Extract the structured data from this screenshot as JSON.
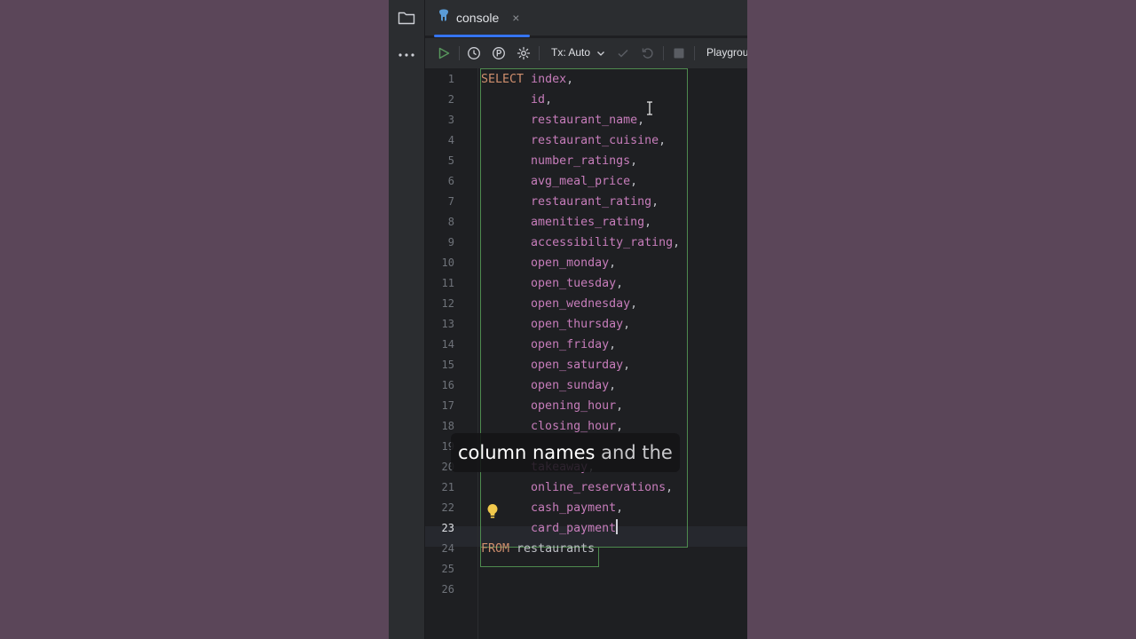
{
  "tab": {
    "label": "console",
    "close": "×"
  },
  "toolbar": {
    "tx_mode": "Tx: Auto",
    "session": "Playground"
  },
  "editor": {
    "lines": [
      {
        "n": "1",
        "keyword": "SELECT",
        "text": "index",
        "suffix": ","
      },
      {
        "n": "2",
        "text": "id",
        "suffix": ","
      },
      {
        "n": "3",
        "text": "restaurant_name",
        "suffix": ","
      },
      {
        "n": "4",
        "text": "restaurant_cuisine",
        "suffix": ","
      },
      {
        "n": "5",
        "text": "number_ratings",
        "suffix": ","
      },
      {
        "n": "6",
        "text": "avg_meal_price",
        "suffix": ","
      },
      {
        "n": "7",
        "text": "restaurant_rating",
        "suffix": ","
      },
      {
        "n": "8",
        "text": "amenities_rating",
        "suffix": ","
      },
      {
        "n": "9",
        "text": "accessibility_rating",
        "suffix": ","
      },
      {
        "n": "10",
        "text": "open_monday",
        "suffix": ","
      },
      {
        "n": "11",
        "text": "open_tuesday",
        "suffix": ","
      },
      {
        "n": "12",
        "text": "open_wednesday",
        "suffix": ","
      },
      {
        "n": "13",
        "text": "open_thursday",
        "suffix": ","
      },
      {
        "n": "14",
        "text": "open_friday",
        "suffix": ","
      },
      {
        "n": "15",
        "text": "open_saturday",
        "suffix": ","
      },
      {
        "n": "16",
        "text": "open_sunday",
        "suffix": ","
      },
      {
        "n": "17",
        "text": "opening_hour",
        "suffix": ","
      },
      {
        "n": "18",
        "text": "closing_hour",
        "suffix": ","
      },
      {
        "n": "19",
        "text": "",
        "suffix": ""
      },
      {
        "n": "20",
        "text": "takeaway",
        "suffix": ","
      },
      {
        "n": "21",
        "text": "online_reservations",
        "suffix": ","
      },
      {
        "n": "22",
        "text": "cash_payment",
        "suffix": ","
      },
      {
        "n": "23",
        "text": "card_payment",
        "suffix": ""
      },
      {
        "n": "24",
        "keyword": "FROM",
        "text": "restaurants",
        "suffix": ""
      },
      {
        "n": "25",
        "text": "",
        "suffix": ""
      },
      {
        "n": "26",
        "text": "",
        "suffix": ""
      }
    ],
    "current_line": "23"
  },
  "subtitle": {
    "part1": "column names",
    "part2": "and the"
  },
  "colors": {
    "keyword": "#cf8e6d",
    "column": "#c77dbb",
    "selection_border": "#4e8a4e",
    "accent": "#3574f0"
  },
  "icons": [
    "folder-icon",
    "more-icon",
    "elephant-icon",
    "run-icon",
    "history-icon",
    "parameters-icon",
    "settings-icon",
    "chevron-down-icon",
    "commit-icon",
    "rollback-icon",
    "stop-icon",
    "lightbulb-icon"
  ]
}
